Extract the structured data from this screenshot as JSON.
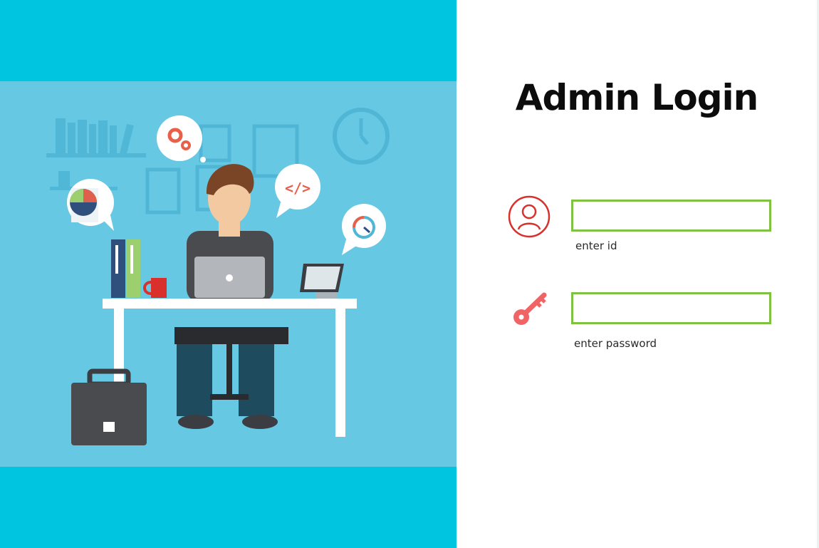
{
  "login": {
    "title": "Admin Login",
    "id_field": {
      "value": "",
      "placeholder": "",
      "hint": "enter id",
      "icon": "user-icon"
    },
    "password_field": {
      "value": "",
      "placeholder": "",
      "hint": "enter password",
      "icon": "key-icon"
    }
  },
  "illustration": {
    "subject": "person-working-at-desk"
  },
  "colors": {
    "left_background": "#00c5e0",
    "illustration_background": "#67c8e4",
    "input_border": "#7fc241",
    "user_icon": "#d9302c",
    "key_icon": "#f06466"
  }
}
